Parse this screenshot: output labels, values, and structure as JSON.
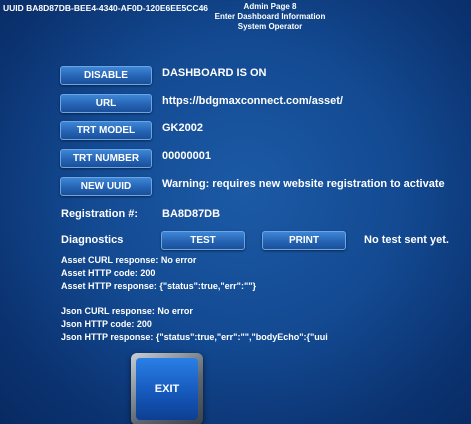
{
  "uuid_label": "UUID BA8D87DB-BEE4-4340-AF0D-120E6EE5CC46",
  "header": {
    "line1": "Admin Page 8",
    "line2": "Enter Dashboard Information",
    "line3": "System Operator"
  },
  "rows": {
    "disable": {
      "button": "DISABLE",
      "value": "DASHBOARD IS ON"
    },
    "url": {
      "button": "URL",
      "value": "https://bdgmaxconnect.com/asset/"
    },
    "trt_model": {
      "button": "TRT MODEL",
      "value": "GK2002"
    },
    "trt_number": {
      "button": "TRT NUMBER",
      "value": "00000001"
    },
    "new_uuid": {
      "button": "NEW UUID",
      "value": "Warning: requires new website registration to activate"
    }
  },
  "registration": {
    "label": "Registration #:",
    "value": "BA8D87DB"
  },
  "diagnostics": {
    "label": "Diagnostics",
    "test_button": "TEST",
    "print_button": "PRINT",
    "status": "No test sent yet."
  },
  "asset": {
    "curl": "Asset CURL response: No error",
    "http_code": "Asset HTTP code: 200",
    "http_response": "Asset HTTP response: {\"status\":true,\"err\":\"\"}"
  },
  "json": {
    "curl": "Json CURL response: No error",
    "http_code": "Json HTTP code: 200",
    "http_response": "Json HTTP response: {\"status\":true,\"err\":\"\",\"bodyEcho\":{\"uui"
  },
  "exit_button": "EXIT"
}
